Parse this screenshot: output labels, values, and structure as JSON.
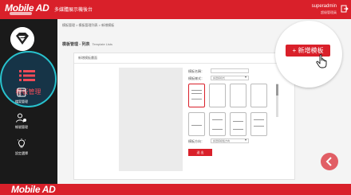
{
  "header": {
    "logo_text": "Mobile AD",
    "app_title": "多媒體展示機後台",
    "username": "superadmin",
    "role": "超級管理員"
  },
  "sidebar": {
    "active_label": "模板管理",
    "items": [
      {
        "label": "檔案管理",
        "icon": "layout-icon"
      },
      {
        "label": "帳號管理",
        "icon": "user-settings-icon"
      },
      {
        "label": "設定選擇",
        "icon": "bulb-icon"
      }
    ]
  },
  "main": {
    "breadcrumb": "模板管理 > 模板管理列表 > 新增模板",
    "title": "模板管理 - 列表",
    "title_sub": "Template Lists",
    "panel_tab": "新增模板畫面",
    "form": {
      "name_label": "模板名稱：",
      "layout_label": "模板樣式：",
      "layout_value": "請選擇樣式",
      "orientation_label": "模板方向：",
      "orientation_value": "請選擇模板方向",
      "submit": "送 出"
    },
    "add_button": "+ 新增模板"
  },
  "footer": {
    "logo_text": "Mobile AD"
  }
}
